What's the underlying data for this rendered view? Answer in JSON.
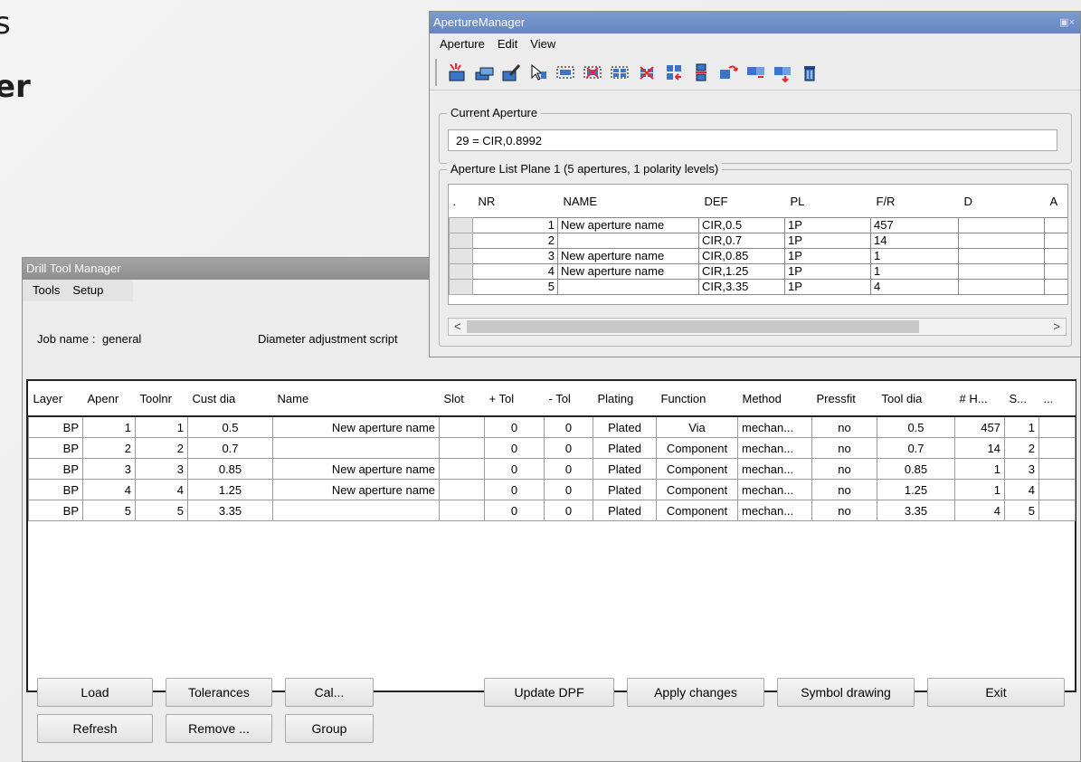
{
  "background": {
    "line1": "s",
    "line2": "er"
  },
  "drill_tool_manager": {
    "title": "Drill Tool Manager",
    "menu": [
      "Tools",
      "Setup"
    ],
    "job_label": "Job name :",
    "job_value": "general",
    "diameter_label": "Diameter adjustment script",
    "columns": [
      "Layer",
      "Apenr",
      "Toolnr",
      "Cust dia",
      "Name",
      "Slot",
      "+ Tol",
      "- Tol",
      "Plating",
      "Function",
      "Method",
      "Pressfit",
      "Tool dia",
      "# H...",
      "S...",
      "..."
    ],
    "rows": [
      [
        "BP",
        "1",
        "1",
        "0.5",
        "New aperture name",
        "",
        "0",
        "0",
        "Plated",
        "Via",
        "mechan...",
        "no",
        "0.5",
        "457",
        "1"
      ],
      [
        "BP",
        "2",
        "2",
        "0.7",
        "",
        "",
        "0",
        "0",
        "Plated",
        "Component",
        "mechan...",
        "no",
        "0.7",
        "14",
        "2"
      ],
      [
        "BP",
        "3",
        "3",
        "0.85",
        "New aperture name",
        "",
        "0",
        "0",
        "Plated",
        "Component",
        "mechan...",
        "no",
        "0.85",
        "1",
        "3"
      ],
      [
        "BP",
        "4",
        "4",
        "1.25",
        "New aperture name",
        "",
        "0",
        "0",
        "Plated",
        "Component",
        "mechan...",
        "no",
        "1.25",
        "1",
        "4"
      ],
      [
        "BP",
        "5",
        "5",
        "3.35",
        "",
        "",
        "0",
        "0",
        "Plated",
        "Component",
        "mechan...",
        "no",
        "3.35",
        "4",
        "5"
      ]
    ],
    "buttons": {
      "load": "Load",
      "tolerances": "Tolerances",
      "cal": "Cal...",
      "update_dpf": "Update DPF",
      "apply_changes": "Apply changes",
      "symbol_drawing": "Symbol drawing",
      "exit": "Exit",
      "refresh": "Refresh",
      "remove": "Remove ...",
      "group": "Group"
    }
  },
  "aperture_manager": {
    "title": "ApertureManager",
    "window_controls": "▣×",
    "menu": [
      "Aperture",
      "Edit",
      "View"
    ],
    "current_label": "Current Aperture",
    "current_value": "29 = CIR,0.8992",
    "list_label": "Aperture List Plane 1 (5 apertures, 1 polarity levels)",
    "columns": [
      ".",
      "NR",
      "NAME",
      "DEF",
      "PL",
      "F/R",
      "D",
      "A"
    ],
    "rows": [
      [
        "1",
        "New aperture name",
        "CIR,0.5",
        "1P",
        "457"
      ],
      [
        "2",
        "",
        "CIR,0.7",
        "1P",
        "14"
      ],
      [
        "3",
        "New aperture name",
        "CIR,0.85",
        "1P",
        "1"
      ],
      [
        "4",
        "New aperture name",
        "CIR,1.25",
        "1P",
        "1"
      ],
      [
        "5",
        "",
        "CIR,3.35",
        "1P",
        "4"
      ]
    ],
    "scroll_left": "<",
    "scroll_right": ">"
  }
}
